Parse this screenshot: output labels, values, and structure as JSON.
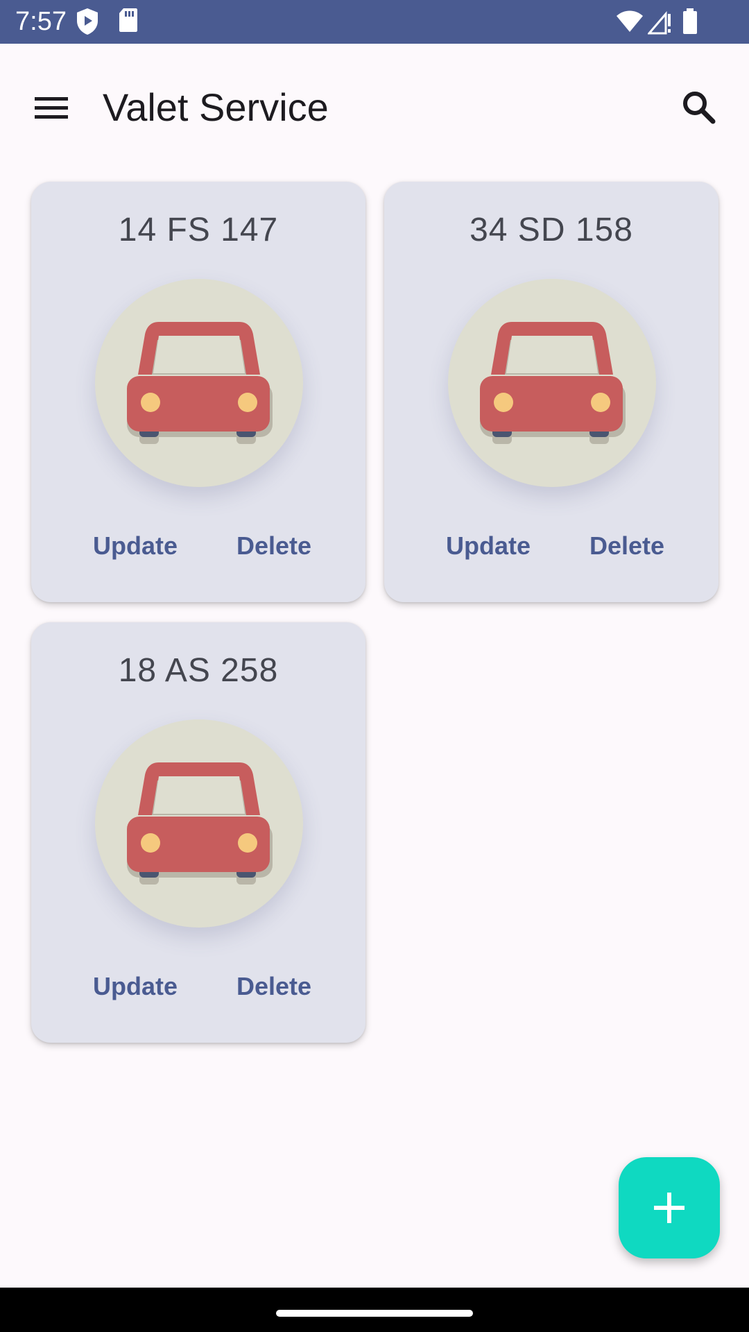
{
  "status_bar": {
    "time": "7:57",
    "icons": [
      "play-protect-icon",
      "sd-card-icon",
      "wifi-icon",
      "signal-icon",
      "battery-icon"
    ],
    "color": "#4a5b91"
  },
  "app_bar": {
    "title": "Valet Service",
    "menu_icon": "menu-icon",
    "search_icon": "search-icon"
  },
  "cars": [
    {
      "plate": "14 FS 147",
      "update_label": "Update",
      "delete_label": "Delete"
    },
    {
      "plate": "34 SD 158",
      "update_label": "Update",
      "delete_label": "Delete"
    },
    {
      "plate": "18 AS 258",
      "update_label": "Update",
      "delete_label": "Delete"
    }
  ],
  "fab": {
    "icon": "plus-icon",
    "color": "#0fd9c1"
  },
  "colors": {
    "accent": "#4a5b91",
    "card_background": "#e1e2ec",
    "car_body": "#c75d5d",
    "car_circle": "#deded0",
    "headlight": "#f5c97e"
  }
}
